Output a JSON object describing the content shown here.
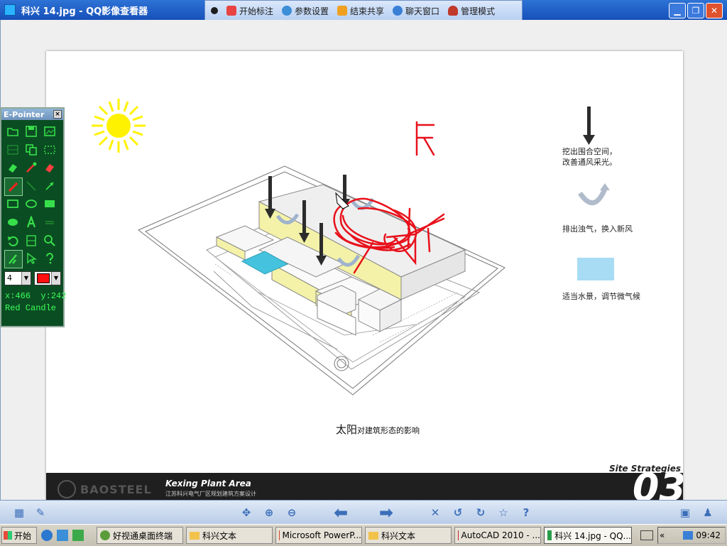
{
  "window": {
    "title": "科兴 14.jpg - QQ影像查看器"
  },
  "toolbar": {
    "items": [
      {
        "label": "开始标注",
        "icon": "pen-icon"
      },
      {
        "label": "参数设置",
        "icon": "settings-icon"
      },
      {
        "label": "结束共享",
        "icon": "stop-share-icon"
      },
      {
        "label": "聊天窗口",
        "icon": "chat-icon"
      },
      {
        "label": "管理模式",
        "icon": "admin-icon"
      }
    ]
  },
  "slide": {
    "legend": {
      "item1": "挖出围合空间，\n改善通风采光。",
      "item2": "排出浊气，换入新风",
      "item3": "适当水景，调节微气候"
    },
    "caption_main": "太阳",
    "caption_rest": "对建筑形态的影响",
    "footer_title": "Kexing Plant Area",
    "footer_subtitle": "江苏科兴电气厂区规划建筑方案设计",
    "logo_text": "BAOSTEEL",
    "section_label": "Site Strategies",
    "section_number": "03",
    "colors": {
      "water": "#45c3de",
      "accent_yellow": "#f3f2a8",
      "annotation_red": "#e8111b"
    }
  },
  "epointer": {
    "title": "E-Pointer",
    "close_label": "×",
    "pen_width": "4",
    "pen_color": "#ff1010",
    "coords_x": "x:466",
    "coords_y": "y:242",
    "status": "Red Candle"
  },
  "taskbar": {
    "start_label": "开始",
    "tasks": [
      "好视通桌面终端",
      "科兴文本",
      "Microsoft PowerP...",
      "科兴文本",
      "AutoCAD 2010 - ...",
      "科兴 14.jpg - QQ..."
    ],
    "clock": "09:42"
  }
}
